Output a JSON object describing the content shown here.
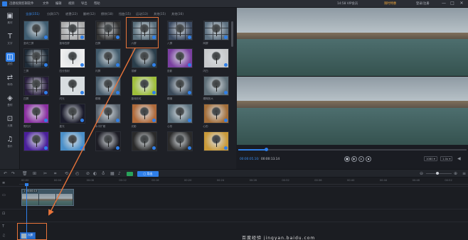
{
  "titlebar": {
    "app_title": "迅捷视频剪辑软件",
    "menu": [
      "文件",
      "编辑",
      "视频",
      "导出",
      "帮助"
    ],
    "account_text": "14:58 VIP会员",
    "promo_text": "限时特惠",
    "vip_text": "登录/注册",
    "window_buttons": [
      "—",
      "□",
      "✕"
    ]
  },
  "sidebar": {
    "items": [
      {
        "icon": "play-square-icon",
        "label": "素材"
      },
      {
        "icon": "text-icon",
        "label": "文字"
      },
      {
        "icon": "filter-icon",
        "label": "滤镜"
      },
      {
        "icon": "transition-icon",
        "label": "转场"
      },
      {
        "icon": "overlay-icon",
        "label": "叠附"
      },
      {
        "icon": "element-icon",
        "label": "元素"
      },
      {
        "icon": "music-icon",
        "label": "音乐"
      }
    ],
    "active_index": 2
  },
  "media_panel": {
    "tabs": [
      "全部(151)",
      "分屏(17)",
      "遮罩(22)",
      "翻转(12)",
      "擦除(18)",
      "扭曲(15)",
      "运动(13)",
      "其他(15)",
      "其他(16)"
    ],
    "active_tab": 0,
    "thumbnails": [
      {
        "label": "竖向三屏"
      },
      {
        "label": "旋转四屏"
      },
      {
        "label": "四屏"
      },
      {
        "label": "六屏"
      },
      {
        "label": "八屏"
      },
      {
        "label": "网屏"
      },
      {
        "label": "三屏"
      },
      {
        "label": "四分放射"
      },
      {
        "label": "闪屏"
      },
      {
        "label": "溶解"
      },
      {
        "label": "迭影"
      },
      {
        "label": "闪白"
      },
      {
        "label": "四屏"
      },
      {
        "label": "闪光"
      },
      {
        "label": "模糊"
      },
      {
        "label": "旋转彩虹"
      },
      {
        "label": "模糊"
      },
      {
        "label": "模糊放大"
      },
      {
        "label": "霓虹灯"
      },
      {
        "label": "星光"
      },
      {
        "label": "水平扩散"
      },
      {
        "label": "光影"
      },
      {
        "label": "心形"
      },
      {
        "label": "心形"
      },
      {
        "label": ""
      },
      {
        "label": ""
      },
      {
        "label": ""
      },
      {
        "label": ""
      },
      {
        "label": ""
      },
      {
        "label": ""
      }
    ]
  },
  "preview": {
    "current_time": "00:00:05.10",
    "total_time": "00:00:13.14",
    "quality": "1080",
    "speed": "1.0x",
    "progress": 0.12
  },
  "toolbar": {
    "export_label": "导出"
  },
  "timeline": {
    "ruler_ticks": [
      "00:00",
      "00:04",
      "00:08",
      "00:12",
      "00:16",
      "00:20",
      "00:24",
      "00:28",
      "00:32",
      "00:36",
      "00:40",
      "00:44",
      "00:48",
      "00:52"
    ],
    "video_clip_label": "1 00:00:13",
    "transition_clip_label": "六屏",
    "track_icons": [
      "video-track-icon",
      "pip-track-icon",
      "text-track-icon",
      "music-track-icon"
    ]
  },
  "watermark": "百度经验 jingyan.baidu.com",
  "colors": {
    "accent": "#2f7fe8",
    "highlight": "#e8743a"
  }
}
